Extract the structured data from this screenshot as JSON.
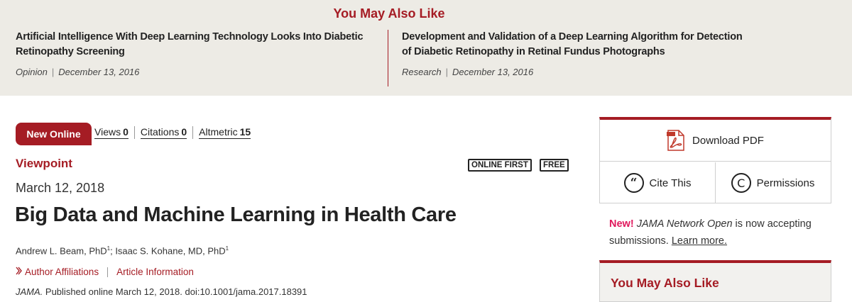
{
  "banner": {
    "title": "You May Also Like",
    "items": [
      {
        "title_line1": "Artificial Intelligence With Deep Learning Technology Looks Into Diabetic",
        "title_line2": "Retinopathy Screening",
        "type": "Opinion",
        "date": "December 13, 2016"
      },
      {
        "title_line1": "Development and Validation of a Deep Learning Algorithm for Detection",
        "title_line2": "of Diabetic Retinopathy in Retinal Fundus Photographs",
        "type": "Research",
        "date": "December 13, 2016"
      }
    ]
  },
  "article": {
    "badge": "New Online",
    "metrics": {
      "views_label": "Views",
      "views_value": "0",
      "citations_label": "Citations",
      "citations_value": "0",
      "altmetric_label": "Altmetric",
      "altmetric_value": "15"
    },
    "section": "Viewpoint",
    "tags": [
      "ONLINE FIRST",
      "FREE"
    ],
    "date": "March 12, 2018",
    "title": "Big Data and Machine Learning in Health Care",
    "authors": {
      "author1": "Andrew L. Beam, PhD",
      "author1_sup": "1",
      "separator": "; ",
      "author2": "Isaac S. Kohane, MD, PhD",
      "author2_sup": "1"
    },
    "links": {
      "affiliations": "Author Affiliations",
      "info": "Article Information"
    },
    "citation": {
      "journal": "JAMA.",
      "text": " Published online March 12, 2018. doi:10.1001/jama.2017.18391"
    }
  },
  "sidebar": {
    "download_pdf": "Download PDF",
    "cite_this": "Cite This",
    "permissions": "Permissions",
    "promo": {
      "new": "New!",
      "journal": "JAMA Network Open",
      "text": " is now accepting submissions. ",
      "more": "Learn more."
    },
    "you_may_also_like": "You May Also Like"
  },
  "colors": {
    "brand": "#a51c24",
    "banner_bg": "#edebe5",
    "promo_new": "#e0185c"
  },
  "icons": [
    "pdf-icon",
    "quote-icon",
    "copyright-icon",
    "chevron-right-icon"
  ]
}
